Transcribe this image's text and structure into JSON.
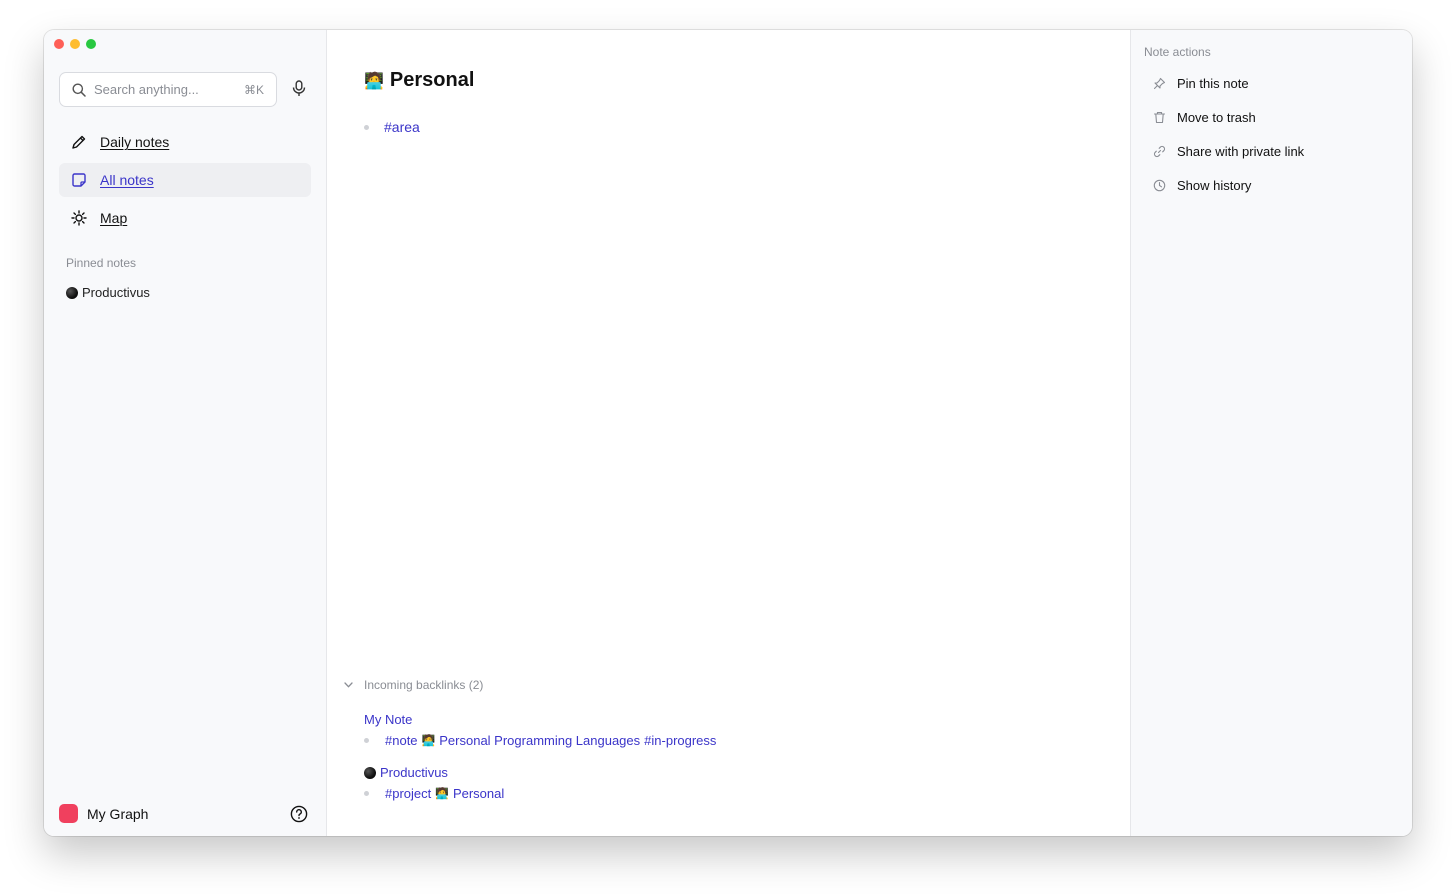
{
  "sidebar": {
    "search": {
      "placeholder": "Search anything...",
      "shortcut": "⌘K"
    },
    "nav": [
      {
        "label": "Daily notes",
        "icon": "pencil-icon"
      },
      {
        "label": "All notes",
        "icon": "note-icon",
        "active": true
      },
      {
        "label": "Map",
        "icon": "sun-icon"
      }
    ],
    "pinned_title": "Pinned notes",
    "pinned": [
      {
        "label": "Productivus",
        "icon": "black-circle-icon"
      }
    ],
    "graph": {
      "label": "My Graph",
      "color": "#f0405e"
    }
  },
  "note": {
    "title": "Personal",
    "title_emoji": "🧑‍💻",
    "tags": [
      "#area"
    ]
  },
  "backlinks": {
    "header": "Incoming backlinks (2)",
    "items": [
      {
        "note": "My Note",
        "line": [
          "#note",
          "Personal Programming Languages",
          "#in-progress"
        ]
      },
      {
        "note": "Productivus",
        "line": [
          "#project",
          "Personal"
        ]
      }
    ]
  },
  "actions": {
    "title": "Note actions",
    "items": [
      {
        "label": "Pin this note",
        "icon": "pin-icon"
      },
      {
        "label": "Move to trash",
        "icon": "trash-icon"
      },
      {
        "label": "Share with private link",
        "icon": "link-icon"
      },
      {
        "label": "Show history",
        "icon": "clock-icon"
      }
    ]
  },
  "colors": {
    "accent": "#3b35c9",
    "graph": "#f0405e"
  }
}
